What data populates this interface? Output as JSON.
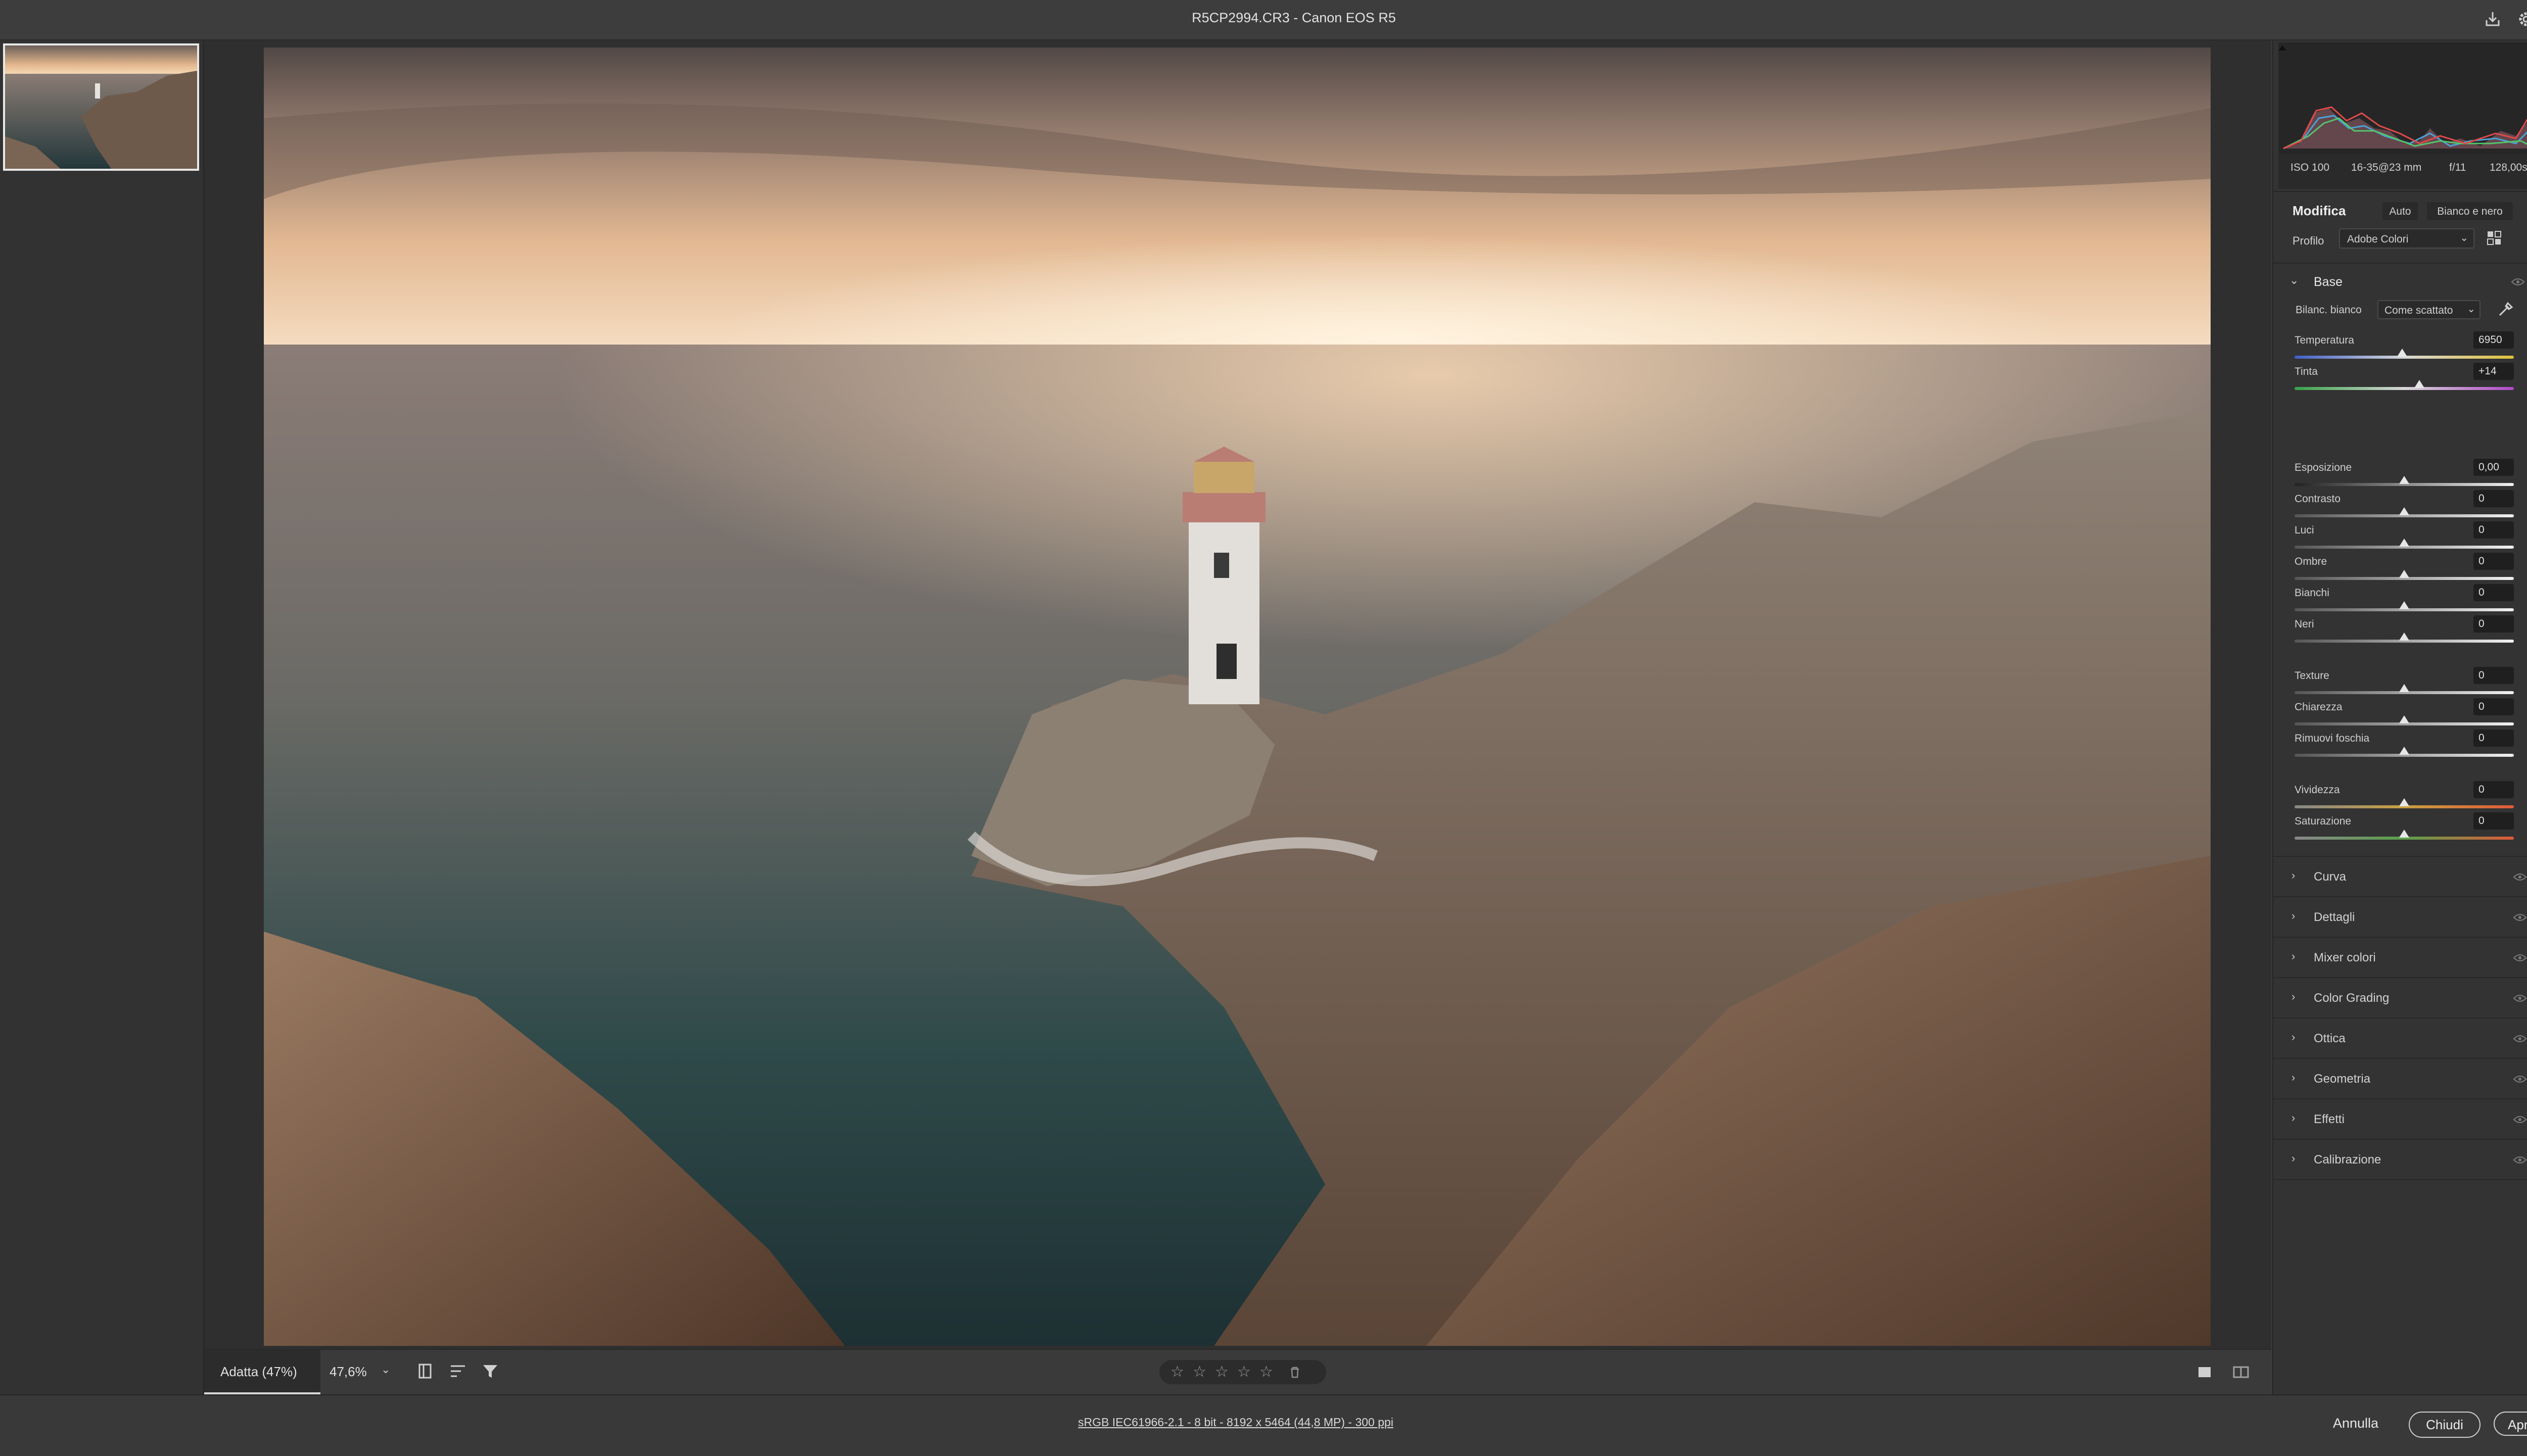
{
  "window": {
    "title": "R5CP2994.CR3  -  Canon EOS R5"
  },
  "histogram": {
    "iso": "ISO 100",
    "lens": "16-35@23 mm",
    "aperture": "f/11",
    "shutter": "128,00s"
  },
  "panel": {
    "edit_title": "Modifica",
    "auto_label": "Auto",
    "bw_label": "Bianco e nero",
    "profile_label": "Profilo",
    "profile_value": "Adobe Colori",
    "base_title": "Base",
    "wb_label": "Bilanc. bianco",
    "wb_value": "Come scattato",
    "sliders": [
      {
        "label": "Temperatura",
        "value": "6950",
        "pos": 0.49
      },
      {
        "label": "Tinta",
        "value": "+14",
        "pos": 0.57
      },
      {
        "label": "Esposizione",
        "value": "0,00",
        "pos": 0.5
      },
      {
        "label": "Contrasto",
        "value": "0",
        "pos": 0.5
      },
      {
        "label": "Luci",
        "value": "0",
        "pos": 0.5
      },
      {
        "label": "Ombre",
        "value": "0",
        "pos": 0.5
      },
      {
        "label": "Bianchi",
        "value": "0",
        "pos": 0.5
      },
      {
        "label": "Neri",
        "value": "0",
        "pos": 0.5
      },
      {
        "label": "Texture",
        "value": "0",
        "pos": 0.5
      },
      {
        "label": "Chiarezza",
        "value": "0",
        "pos": 0.5
      },
      {
        "label": "Rimuovi foschia",
        "value": "0",
        "pos": 0.5
      },
      {
        "label": "Vividezza",
        "value": "0",
        "pos": 0.5
      },
      {
        "label": "Saturazione",
        "value": "0",
        "pos": 0.5
      }
    ],
    "sections": [
      "Curva",
      "Dettagli",
      "Mixer colori",
      "Color Grading",
      "Ottica",
      "Geometria",
      "Effetti",
      "Calibrazione"
    ]
  },
  "bottombar": {
    "zoom_fit": "Adatta (47%)",
    "zoom_value": "47,6%"
  },
  "statusbar": {
    "info": "sRGB IEC61966-2.1 - 8 bit - 8192 x 5464 (44,8 MP) - 300 ppi",
    "cancel_label": "Annulla",
    "close_label": "Chiudi",
    "open_label": "Apri"
  },
  "icons": {
    "title_right": [
      "save-icon",
      "gear-icon",
      "collapse-icon"
    ],
    "toolstrip": [
      "edit-sliders-icon",
      "crop-icon",
      "healing-icon",
      "masking-icon",
      "red-eye-icon",
      "presets-icon",
      "snapshots-icon",
      "more-icon",
      "zoom-icon",
      "hand-icon",
      "color-sampler-icon",
      "grid-icon"
    ]
  }
}
